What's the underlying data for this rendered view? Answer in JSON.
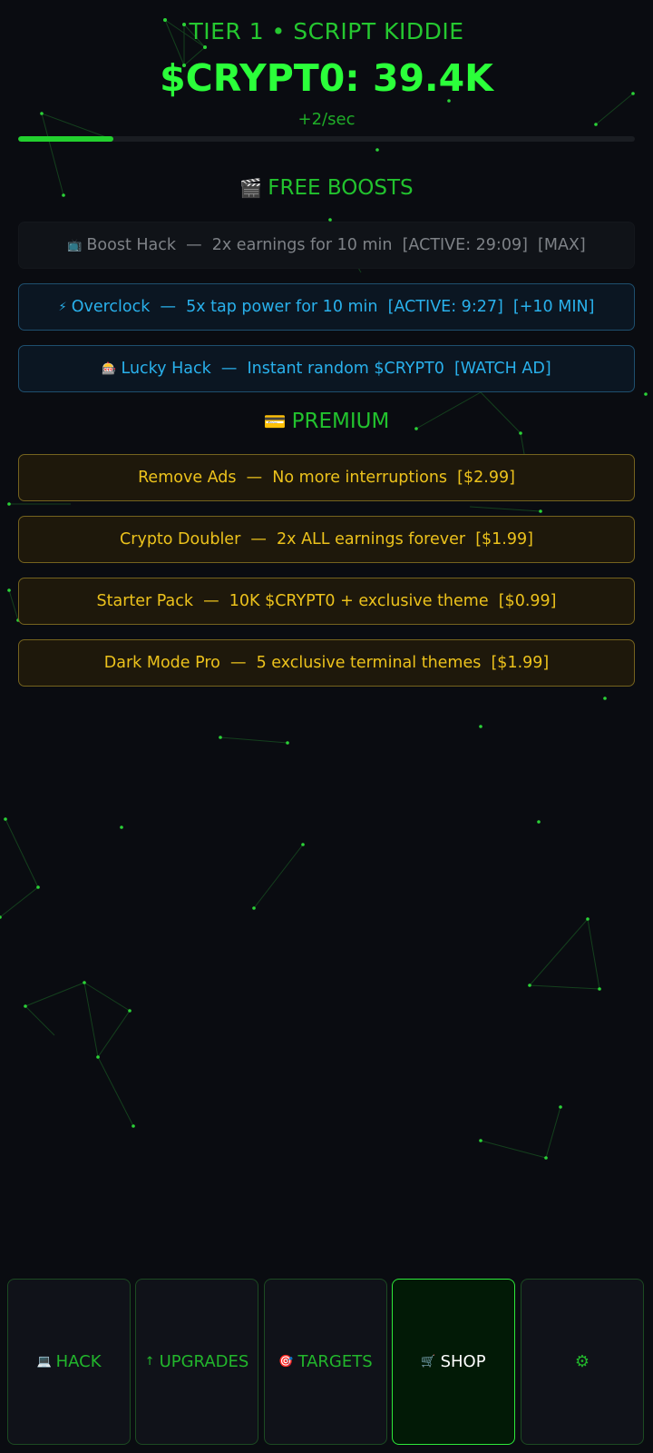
{
  "header": {
    "tier_label": "TIER 1 • SCRIPT KIDDIE",
    "balance": "$CRYPT0: 39.4K",
    "rate": "+2/sec",
    "tier_progress_fraction": 0.155
  },
  "free_boosts": {
    "title": "FREE BOOSTS",
    "title_icon": "🎬",
    "items": [
      {
        "icon": "📺",
        "text": "Boost Hack  —  2x earnings for 10 min  [ACTIVE: 29:09]  [MAX]",
        "state": "maxed"
      },
      {
        "icon": "⚡",
        "text": "Overclock  —  5x tap power for 10 min  [ACTIVE: 9:27]  [+10 MIN]",
        "state": "active"
      },
      {
        "icon": "🎰",
        "text": "Lucky Hack  —  Instant random $CRYPT0  [WATCH AD]",
        "state": "available"
      }
    ]
  },
  "premium": {
    "title": "PREMIUM",
    "title_icon": "💳",
    "items": [
      {
        "text": "Remove Ads  —  No more interruptions  [$2.99]"
      },
      {
        "text": "Crypto Doubler  —  2x ALL earnings forever  [$1.99]"
      },
      {
        "text": "Starter Pack  —  10K $CRYPT0 + exclusive theme  [$0.99]"
      },
      {
        "text": "Dark Mode Pro  —  5 exclusive terminal themes  [$1.99]"
      }
    ]
  },
  "nav": {
    "items": [
      {
        "icon": "💻",
        "label": "HACK"
      },
      {
        "icon": "↑",
        "label": "UPGRADES"
      },
      {
        "icon": "🎯",
        "label": "TARGETS"
      },
      {
        "icon": "🛒",
        "label": "SHOP",
        "active": true
      },
      {
        "icon": "⚙",
        "label": ""
      }
    ]
  },
  "colors": {
    "background": "#0a0c11",
    "terminal_green": "#22c22e",
    "boost_blue": "#29b1ec",
    "premium_gold": "#ecc21c",
    "disabled_gray": "#7e8287"
  }
}
